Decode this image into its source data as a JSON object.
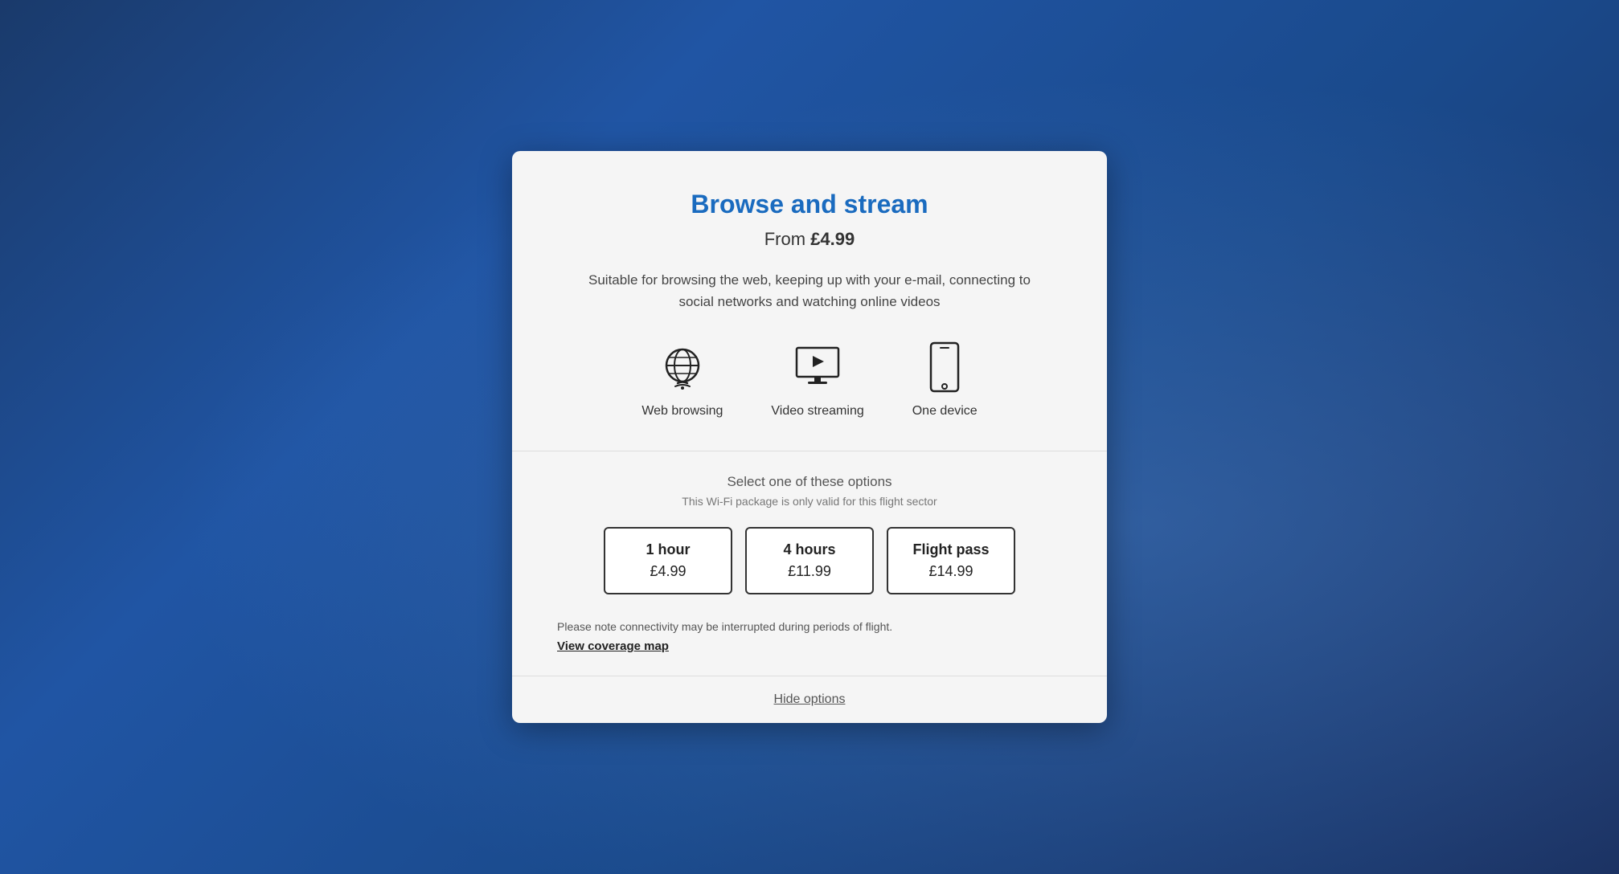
{
  "modal": {
    "title": "Browse and stream",
    "price_prefix": "From ",
    "price_value": "£4.99",
    "description": "Suitable for browsing the web, keeping up with your e-mail, connecting to social networks and watching online videos",
    "features": [
      {
        "id": "web-browsing",
        "label": "Web browsing",
        "icon": "wifi-icon"
      },
      {
        "id": "video-streaming",
        "label": "Video streaming",
        "icon": "video-icon"
      },
      {
        "id": "one-device",
        "label": "One device",
        "icon": "device-icon"
      }
    ],
    "select_label": "Select one of these options",
    "select_sublabel": "This Wi-Fi package is only valid for this flight sector",
    "options": [
      {
        "id": "1hour",
        "duration": "1 hour",
        "price": "£4.99"
      },
      {
        "id": "4hours",
        "duration": "4 hours",
        "price": "£11.99"
      },
      {
        "id": "flight-pass",
        "duration": "Flight pass",
        "price": "£14.99"
      }
    ],
    "connectivity_note": "Please note connectivity may be interrupted during periods of flight.",
    "coverage_link": "View coverage map",
    "hide_options": "Hide options"
  }
}
